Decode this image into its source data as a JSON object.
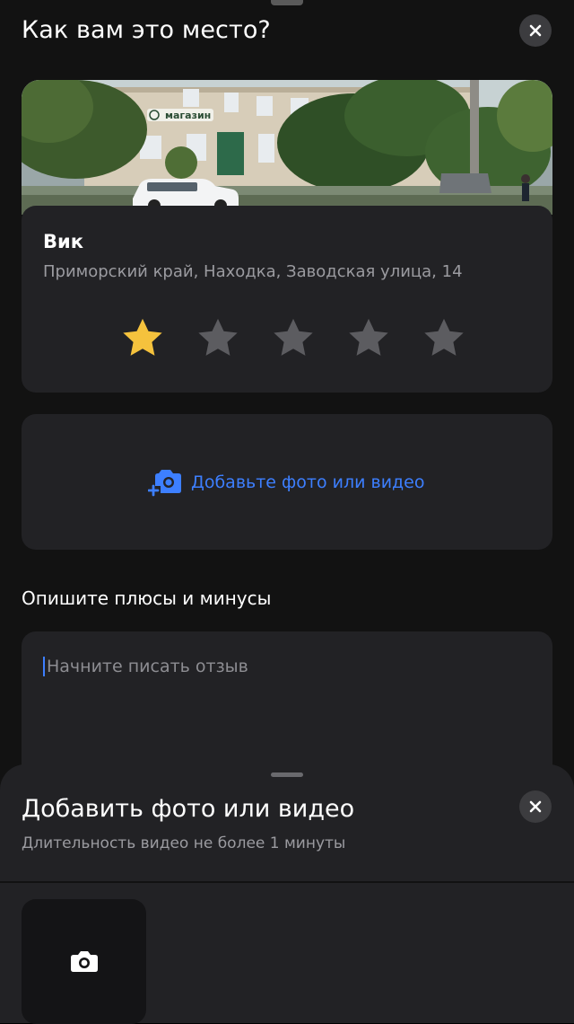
{
  "header": {
    "title": "Как вам это место?"
  },
  "place": {
    "name": "Вик",
    "address": "Приморский край, Находка, Заводская улица, 14",
    "photo_sign": "магазин"
  },
  "rating": {
    "value": 1,
    "max": 5,
    "active_color": "#f5c23d",
    "inactive_color": "#5c5c60"
  },
  "media": {
    "add_label": "Добавьте фото или видео"
  },
  "review": {
    "heading": "Опишите плюсы и минусы",
    "placeholder": "Начните писать отзыв",
    "value": ""
  },
  "bottom_sheet": {
    "title": "Добавить фото или видео",
    "subtitle": "Длительность видео не более 1 минуты",
    "camera_tile_icon": "camera-icon"
  },
  "icons": {
    "close": "close-icon",
    "add_media": "camera-plus-icon",
    "star": "star-icon"
  },
  "colors": {
    "accent": "#3d7fff",
    "background": "#121212",
    "card": "#222225"
  }
}
